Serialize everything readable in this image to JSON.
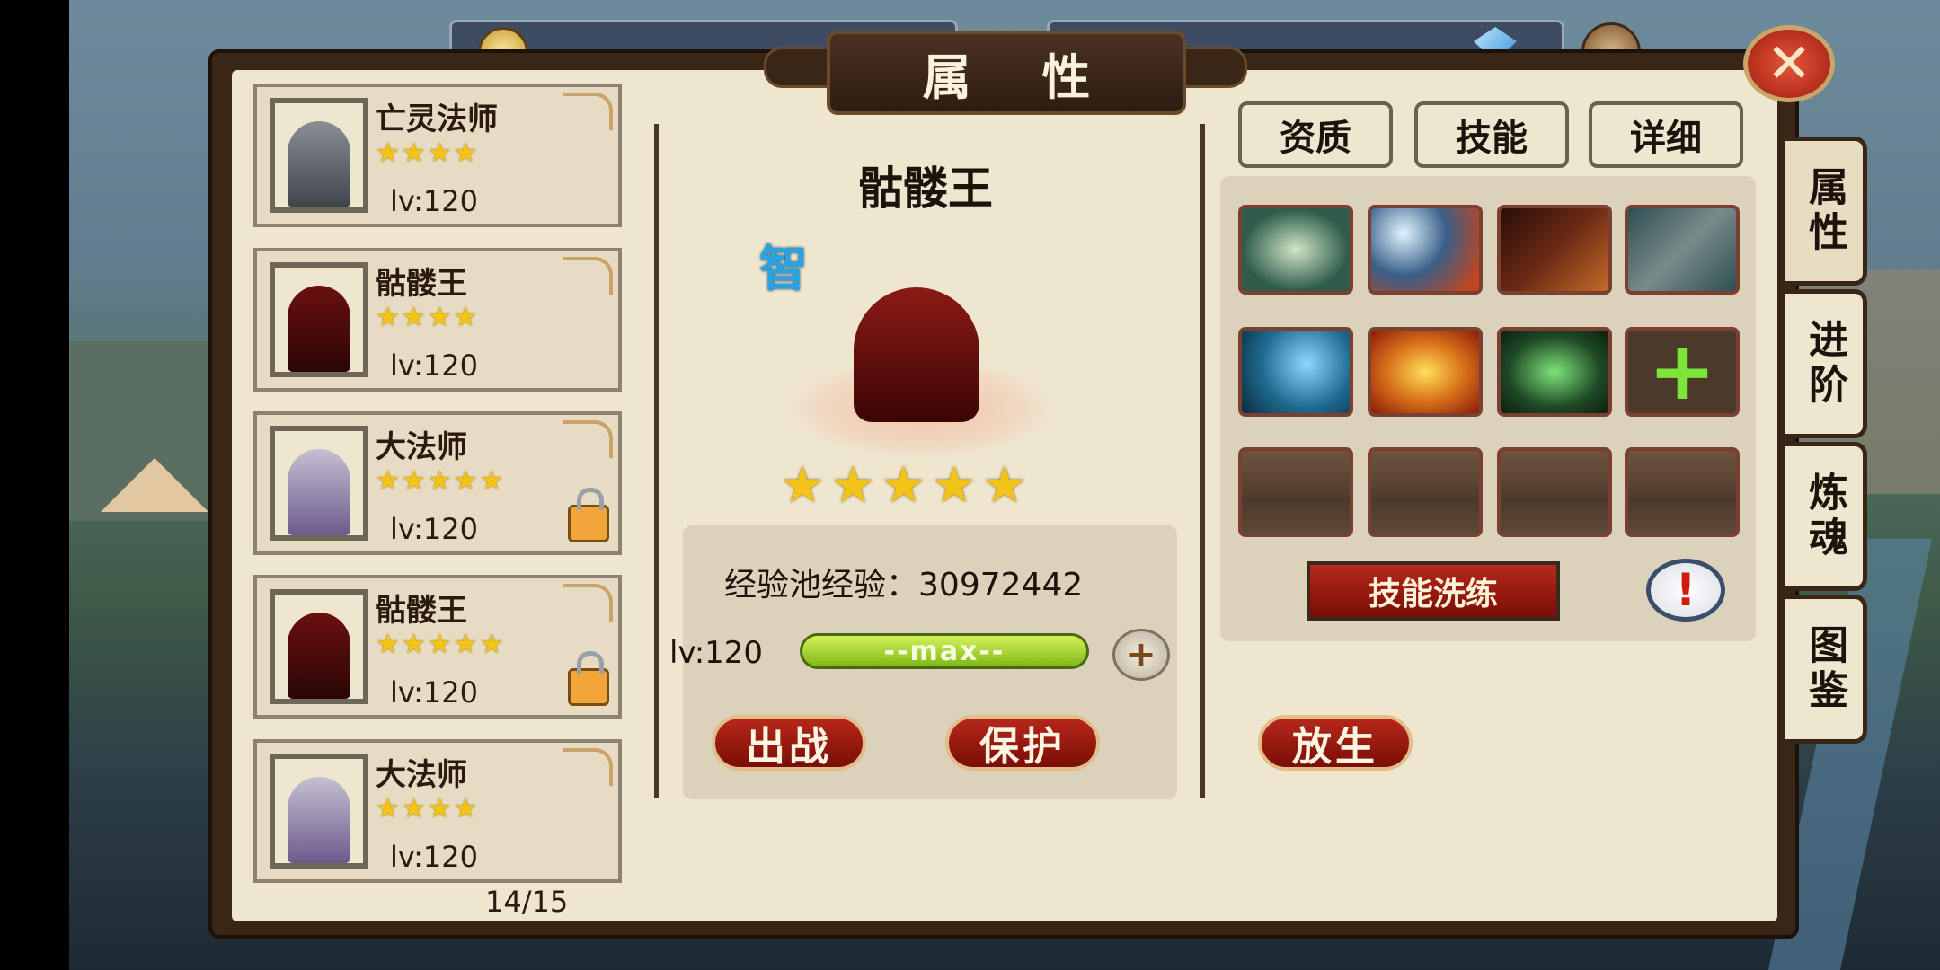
{
  "title": "属 性",
  "hero_list": [
    {
      "name": "亡灵法师",
      "stars": "★★★★",
      "level": "lv:120",
      "locked": false,
      "portrait_icon": "lich-mage-portrait"
    },
    {
      "name": "骷髅王",
      "stars": "★★★★",
      "level": "lv:120",
      "locked": false,
      "portrait_icon": "skeleton-king-portrait"
    },
    {
      "name": "大法师",
      "stars": "★★★★★",
      "level": "lv:120",
      "locked": true,
      "portrait_icon": "archmage-portrait"
    },
    {
      "name": "骷髅王",
      "stars": "★★★★★",
      "level": "lv:120",
      "locked": true,
      "portrait_icon": "skeleton-king-portrait"
    },
    {
      "name": "大法师",
      "stars": "★★★★",
      "level": "lv:120",
      "locked": false,
      "portrait_icon": "archmage-portrait"
    }
  ],
  "page_count": "14/15",
  "selected_hero": {
    "name": "骷髅王",
    "attribute": "智",
    "stars": "★★★★★",
    "exp_pool_label": "经验池经验：",
    "exp_pool_value": "30972442",
    "level": "lv:120",
    "exp_bar_text": "--max--",
    "exp_fraction": 1.0
  },
  "buttons": {
    "deploy": "出战",
    "protect": "保护",
    "release": "放生",
    "skill_wash": "技能洗练",
    "close": "✕",
    "add_exp": "+",
    "info": "!"
  },
  "right_tabs": [
    "资质",
    "技能",
    "详细"
  ],
  "skills": [
    {
      "icon": "green-shield-skill-icon",
      "color": "#2e5b4a"
    },
    {
      "icon": "ice-fist-skill-icon",
      "color": "#3a5f88"
    },
    {
      "icon": "bone-spike-skill-icon",
      "color": "#6b2a14"
    },
    {
      "icon": "chain-skeleton-skill-icon",
      "color": "#2d4f52"
    },
    {
      "icon": "ice-claw-skill-icon",
      "color": "#1f6a8f"
    },
    {
      "icon": "fire-orb-skill-icon",
      "color": "#d8721a"
    },
    {
      "icon": "green-sparkle-skill-icon",
      "color": "#1f4a26"
    },
    {
      "icon": "add-skill-icon",
      "color": "#4b3a2a"
    }
  ],
  "side_tabs": [
    "属性",
    "进阶",
    "炼魂",
    "图鉴"
  ],
  "colors": {
    "accent_red": "#9d1d10",
    "paper": "#efe6cf",
    "frame": "#3a2617",
    "star": "#f3c416",
    "attr_blue": "#29a4e0"
  }
}
